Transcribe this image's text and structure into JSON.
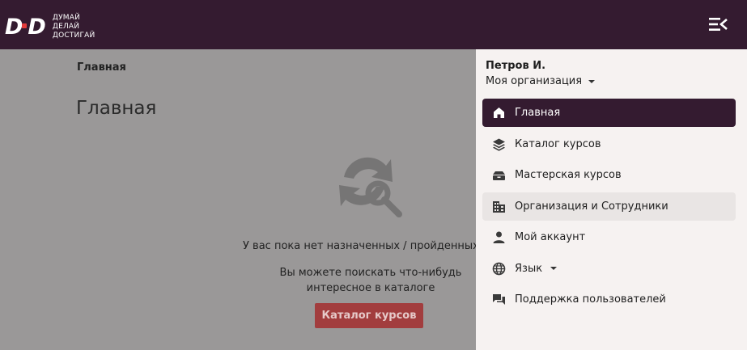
{
  "brand": {
    "logo_mark": "DDD",
    "tagline": [
      "ДУМАЙ",
      "ДЕЛАЙ",
      "ДОСТИГАЙ"
    ]
  },
  "header": {
    "menu_icon": "menu-collapse-icon"
  },
  "main": {
    "breadcrumb": "Главная",
    "title": "Главная",
    "empty_state": {
      "icon": "refresh-search-icon",
      "line1": "У вас пока нет назначенных / пройденных кур",
      "line2": "Вы можете поискать что-нибудь",
      "line3": "интересное в каталоге",
      "button_label": "Каталог курсов"
    }
  },
  "drawer": {
    "user_name": "Петров И.",
    "organization": "Моя организация",
    "items": [
      {
        "label": "Главная",
        "icon": "home-icon",
        "active": true
      },
      {
        "label": "Каталог курсов",
        "icon": "layers-icon"
      },
      {
        "label": "Мастерская курсов",
        "icon": "workshop-icon"
      },
      {
        "label": "Организация и Сотрудники",
        "icon": "building-icon",
        "hovered": true
      },
      {
        "label": "Мой аккаунт",
        "icon": "person-icon"
      },
      {
        "label": "Язык",
        "icon": "globe-icon",
        "has_dropdown": true
      },
      {
        "label": "Поддержка пользователей",
        "icon": "chat-icon"
      }
    ]
  },
  "colors": {
    "topbar": "#341b30",
    "active_item": "#341b30",
    "accent_button": "#a23d3e",
    "drawer_bg": "#f6f2f1",
    "overlay": "#9a9898"
  }
}
